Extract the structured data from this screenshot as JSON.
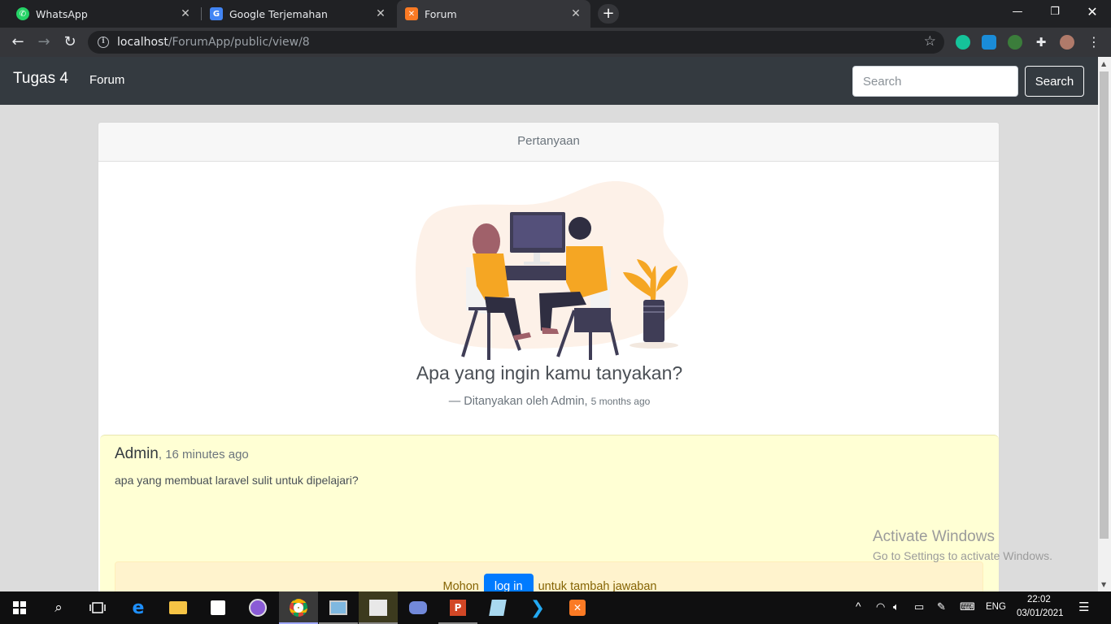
{
  "browser": {
    "tabs": [
      {
        "title": "WhatsApp",
        "icon": "whatsapp-icon",
        "active": false
      },
      {
        "title": "Google Terjemahan",
        "icon": "google-translate-icon",
        "active": false
      },
      {
        "title": "Forum",
        "icon": "xampp-icon",
        "active": true
      }
    ],
    "url_host": "localhost",
    "url_path": "/ForumApp/public/view/8"
  },
  "navbar": {
    "brand": "Tugas 4",
    "link": "Forum",
    "search_placeholder": "Search",
    "search_button": "Search"
  },
  "card": {
    "header": "Pertanyaan",
    "question_title": "Apa yang ingin kamu tanyakan?",
    "meta_prefix": "— Ditanyakan oleh Admin,",
    "meta_time": "5 months ago"
  },
  "answer": {
    "author": "Admin",
    "time": ", 16 minutes ago",
    "body": "apa yang membuat laravel sulit untuk dipelajari?",
    "login_prefix": "Mohon",
    "login_button": "log in",
    "login_suffix": "untuk tambah jawaban"
  },
  "watermark": {
    "line1": "Activate Windows",
    "line2": "Go to Settings to activate Windows."
  },
  "taskbar": {
    "language": "ENG",
    "time": "22:02",
    "date": "03/01/2021"
  },
  "colors": {
    "navbar": "#343a40",
    "accent_orange": "#f5a623",
    "answer_bg": "#ffffd4",
    "login_button": "#007bff"
  }
}
